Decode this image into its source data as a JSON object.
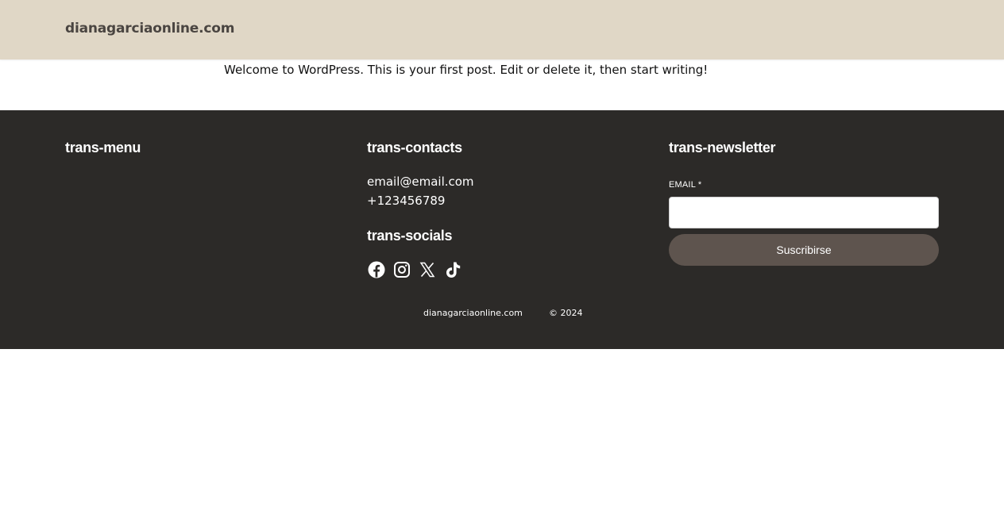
{
  "header": {
    "site_title": "dianagarciaonline.com",
    "background_color": "#e0d7c6"
  },
  "main": {
    "post_text": "Welcome to WordPress. This is your first post. Edit or delete it, then start writing!"
  },
  "footer": {
    "background_color": "#2c2a28",
    "menu": {
      "heading": "trans-menu"
    },
    "contacts": {
      "heading": "trans-contacts",
      "email": "email@email.com",
      "phone": "+123456789"
    },
    "socials": {
      "heading": "trans-socials",
      "icons": [
        "facebook-icon",
        "instagram-icon",
        "x-icon",
        "tiktok-icon"
      ]
    },
    "newsletter": {
      "heading": "trans-newsletter",
      "email_label": "EMAIL *",
      "email_value": "",
      "button_label": "Suscribirse",
      "button_color": "#5e544e"
    },
    "bottom": {
      "site_name": "dianagarciaonline.com",
      "copyright": "© 2024"
    }
  }
}
